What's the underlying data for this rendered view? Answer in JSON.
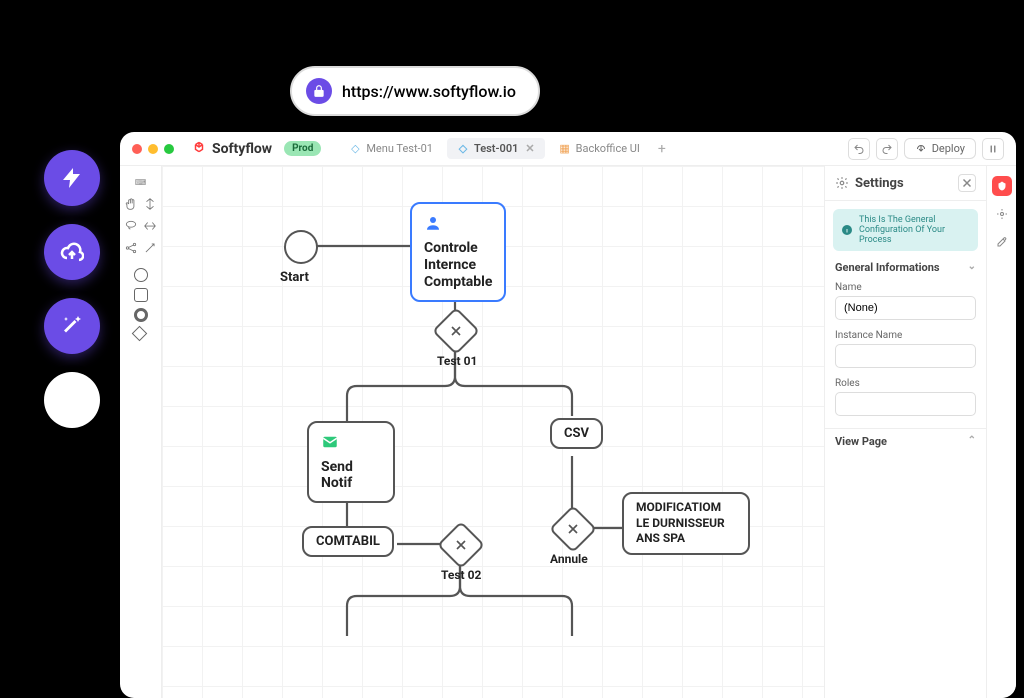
{
  "url": "https://www.softyflow.io",
  "brand": "Softyflow",
  "env_badge": "Prod",
  "tabs": [
    {
      "label": "Menu Test-01",
      "active": false,
      "closable": false,
      "icon": "flow"
    },
    {
      "label": "Test-001",
      "active": true,
      "closable": true,
      "icon": "flow"
    },
    {
      "label": "Backoffice UI",
      "active": false,
      "closable": false,
      "icon": "ui"
    }
  ],
  "deploy_label": "Deploy",
  "flow": {
    "start_label": "Start",
    "controle": "Controle\nInternce\nComptable",
    "test01": "Test 01",
    "send_notif": "Send Notif",
    "csv": "CSV",
    "comtabil": "COMTABIL",
    "test02": "Test 02",
    "annule": "Annule",
    "modification": "MODIFICATIOM\nLE DURNISSEUR\nANS SPA"
  },
  "settings": {
    "title": "Settings",
    "banner": "This Is The General Configuration Of Your Process",
    "sections": {
      "general": "General Informations",
      "view_page": "View Page"
    },
    "fields": {
      "name_label": "Name",
      "name_value": "(None)",
      "instance_name_label": "Instance Name",
      "instance_name_value": "",
      "roles_label": "Roles",
      "roles_value": ""
    }
  }
}
